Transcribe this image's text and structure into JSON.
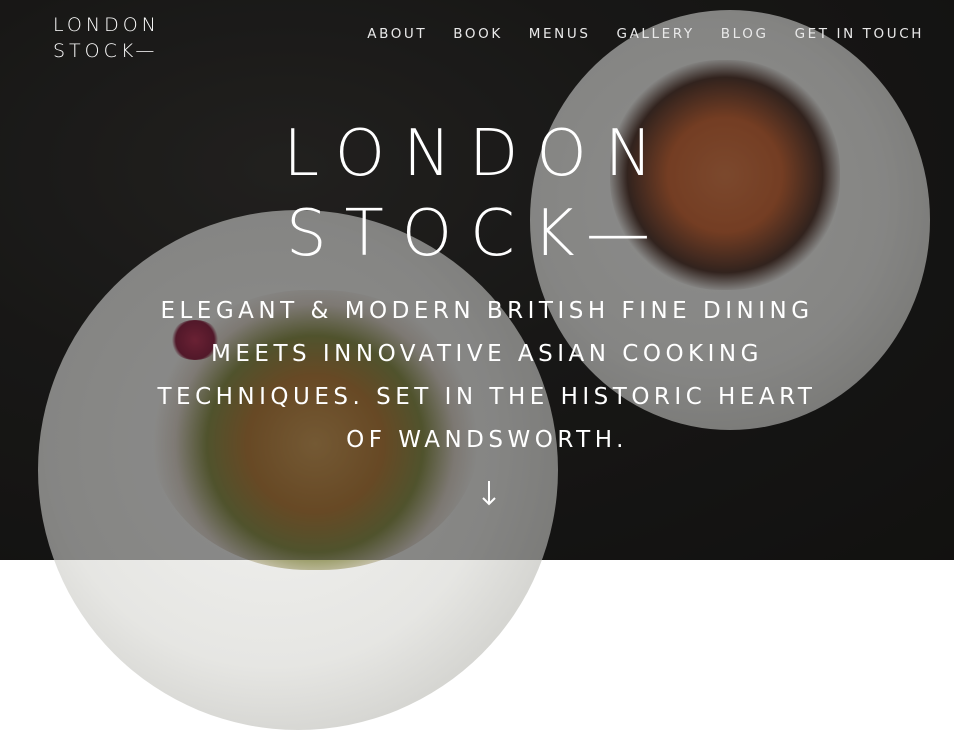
{
  "logo": {
    "line1": "LONDON",
    "line2": "STOCK—"
  },
  "nav": {
    "items": [
      {
        "label": "ABOUT"
      },
      {
        "label": "BOOK"
      },
      {
        "label": "MENUS"
      },
      {
        "label": "GALLERY"
      },
      {
        "label": "BLOG"
      },
      {
        "label": "GET IN TOUCH"
      }
    ]
  },
  "hero": {
    "title_line1": "LONDON",
    "title_line2": "STOCK—",
    "tagline": "ELEGANT & MODERN BRITISH FINE DINING MEETS INNOVATIVE ASIAN COOKING TECHNIQUES. SET IN THE HISTORIC HEART OF WANDSWORTH.",
    "scroll_icon": "arrow-down-icon"
  },
  "colors": {
    "text": "#ffffff",
    "background": "#2a2927"
  }
}
